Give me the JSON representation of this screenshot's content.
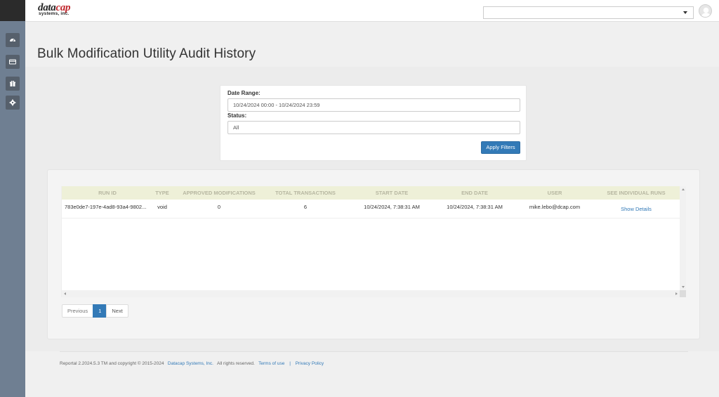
{
  "brand": {
    "name_prefix": "data",
    "name_accent": "cap",
    "sub": "systems, inc.",
    "colors": {
      "brand": "#c0272d",
      "accent": "#337ab7",
      "rail": "#6f7f92"
    }
  },
  "header": {
    "select_value": "",
    "avatar_icon": "user-avatar-icon"
  },
  "sidebar": {
    "items": [
      {
        "name": "dashboard",
        "icon": "dashboard-icon"
      },
      {
        "name": "payments",
        "icon": "credit-card-icon"
      },
      {
        "name": "gifts",
        "icon": "gift-icon"
      },
      {
        "name": "settings",
        "icon": "gear-icon"
      }
    ]
  },
  "page": {
    "title": "Bulk Modification Utility Audit History"
  },
  "filters": {
    "date_range_label": "Date Range:",
    "date_range_value": "10/24/2024 00:00 - 10/24/2024 23:59",
    "status_label": "Status:",
    "status_value": "All",
    "apply_label": "Apply Filters"
  },
  "table": {
    "headers": [
      "RUN ID",
      "TYPE",
      "APPROVED MODIFICATIONS",
      "TOTAL TRANSACTIONS",
      "START DATE",
      "END DATE",
      "USER",
      "SEE INDIVIDUAL RUNS"
    ],
    "rows": [
      {
        "run_id": "783e0de7-197e-4ad8-93a4-9802...",
        "type": "void",
        "approved": "0",
        "total": "6",
        "start": "10/24/2024, 7:38:31 AM",
        "end": "10/24/2024, 7:38:31 AM",
        "user": "mike.lebo@dcap.com",
        "action": "Show Details"
      }
    ]
  },
  "pager": {
    "previous": "Previous",
    "current": "1",
    "next": "Next"
  },
  "footer": {
    "copyright": "Reportal 2.2024.5.3 TM and copyright © 2015-2024",
    "company": "Datacap Systems, Inc.",
    "rights": "All rights reserved.",
    "terms": "Terms of use",
    "separator": "|",
    "privacy": "Privacy Policy"
  }
}
